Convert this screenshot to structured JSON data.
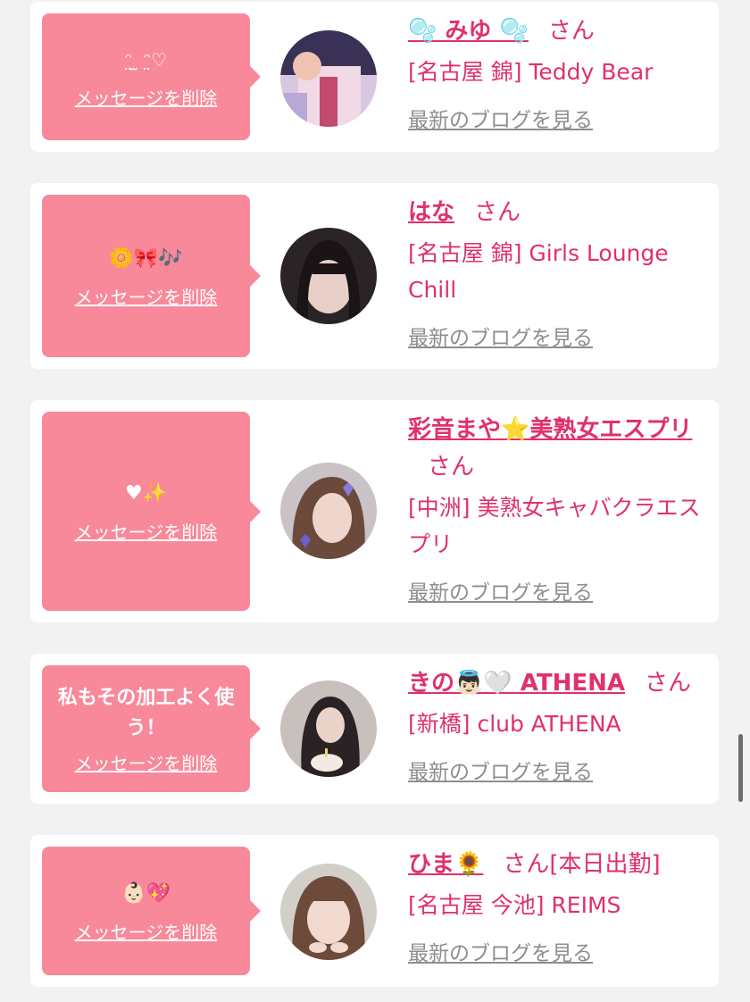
{
  "delete_label": "メッセージを削除",
  "san_label": "さん",
  "blog_label": "最新のブログを見る",
  "colors": {
    "accent": "#e0316a",
    "bubble": "#f7899a",
    "muted": "#8e8e8e",
    "background": "#f2f2f2"
  },
  "items": [
    {
      "message": "ᵔ̤ ̫ ᵔ̤♡",
      "name": "🫧 みゆ 🫧",
      "suffix": "",
      "shop": "[名古屋 錦] Teddy Bear"
    },
    {
      "message": "🌼🎀🎶",
      "name": "はな",
      "suffix": "",
      "shop": "[名古屋 錦] Girls Lounge Chill"
    },
    {
      "message": "♥✨",
      "name": "彩音まや⭐美熟女エスプリ",
      "suffix": "",
      "shop": "[中洲] 美熟女キャバクラエスプリ"
    },
    {
      "message": "私もその加工よく使う！",
      "name": "きの👼🏻🤍 ATHENA",
      "suffix": "",
      "shop": "[新橋] club ATHENA"
    },
    {
      "message": "👶🏻💖",
      "name": "ひま🌻",
      "suffix": "[本日出勤]",
      "shop": "[名古屋 今池] REIMS"
    }
  ]
}
